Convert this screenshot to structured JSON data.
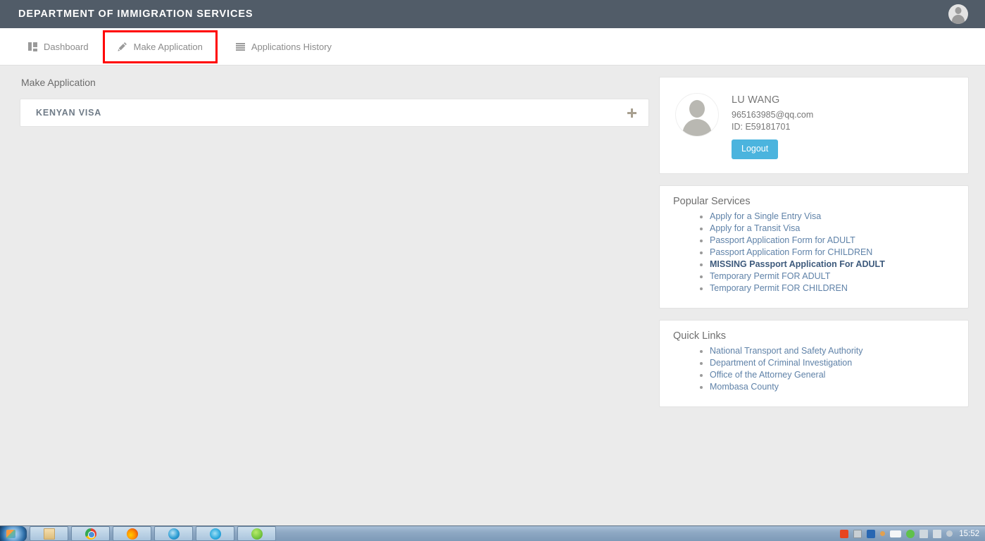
{
  "header": {
    "title": "DEPARTMENT OF IMMIGRATION SERVICES",
    "avatar_icon": "user-avatar-icon"
  },
  "nav": {
    "items": [
      {
        "label": "Dashboard",
        "icon": "grid-icon",
        "highlighted": false
      },
      {
        "label": "Make Application",
        "icon": "pencil-icon",
        "highlighted": true
      },
      {
        "label": "Applications History",
        "icon": "list-icon",
        "highlighted": false
      }
    ],
    "highlight_color": "#ff0000"
  },
  "main": {
    "page_title": "Make Application",
    "accordion": {
      "title": "KENYAN VISA",
      "expand_icon": "plus-icon"
    }
  },
  "sidebar": {
    "profile": {
      "avatar_icon": "user-avatar-icon",
      "name": "LU WANG",
      "email": "965163985@qq.com",
      "id": "ID: E59181701",
      "logout_label": "Logout",
      "logout_color": "#4bb4de"
    },
    "popular_services": {
      "heading": "Popular Services",
      "links": [
        {
          "label": "Apply for a Single Entry Visa",
          "bold": false
        },
        {
          "label": "Apply for a Transit Visa",
          "bold": false
        },
        {
          "label": "Passport Application Form for ADULT",
          "bold": false
        },
        {
          "label": "Passport Application Form for CHILDREN",
          "bold": false
        },
        {
          "label": "MISSING Passport Application For ADULT",
          "bold": true
        },
        {
          "label": "Temporary Permit FOR ADULT",
          "bold": false
        },
        {
          "label": "Temporary Permit FOR CHILDREN",
          "bold": false
        }
      ]
    },
    "quick_links": {
      "heading": "Quick Links",
      "links": [
        {
          "label": "National Transport and Safety Authority",
          "bold": false
        },
        {
          "label": "Department of Criminal Investigation",
          "bold": false
        },
        {
          "label": "Office of the Attorney General",
          "bold": false
        },
        {
          "label": "Mombasa County",
          "bold": false
        }
      ]
    }
  },
  "taskbar": {
    "start_icon": "windows-start-orb-icon",
    "buttons": [
      {
        "icon": "folder-explorer-icon"
      },
      {
        "icon": "chrome-icon"
      },
      {
        "icon": "firefox-icon"
      },
      {
        "icon": "internet-explorer-icon"
      },
      {
        "icon": "edge-browser-icon"
      },
      {
        "icon": "wechat-icon"
      }
    ],
    "tray_icons": [
      "red-app-icon",
      "grey-app-icon",
      "blue-app-icon",
      "orange-dot-icon",
      "white-app-icon",
      "green-dot-icon",
      "tray-note-icon",
      "tray-plug-icon",
      "tray-circle-icon"
    ],
    "clock": "15:52"
  }
}
